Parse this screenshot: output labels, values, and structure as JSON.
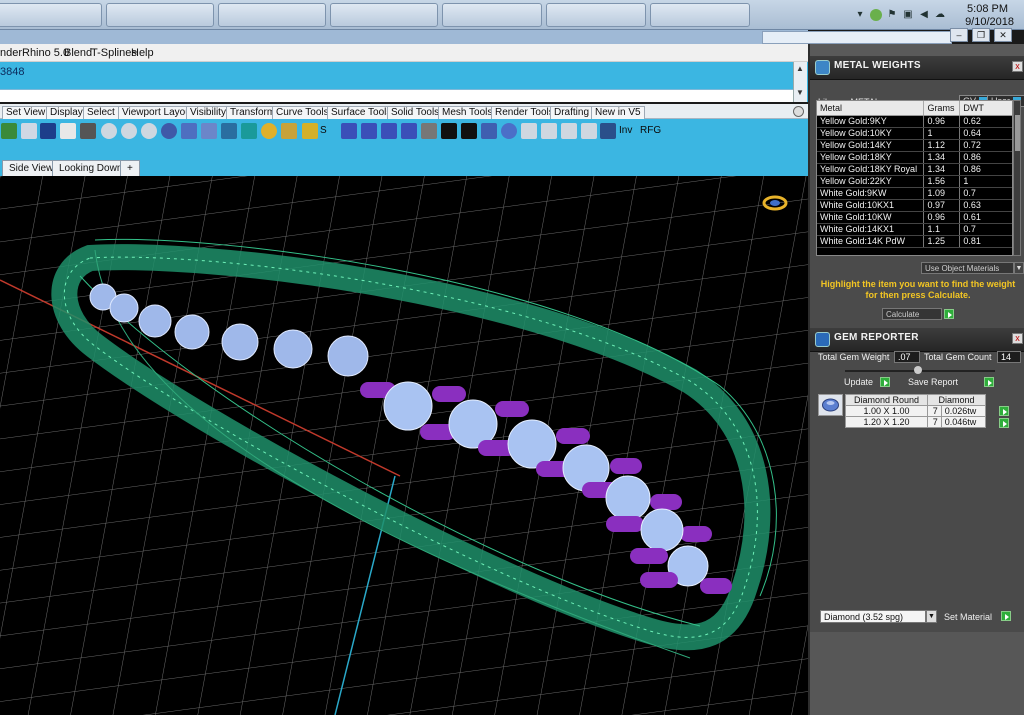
{
  "taskbar": {
    "time": "5:08 PM",
    "date": "9/10/2018",
    "tray_icons": [
      "chevron-up-icon",
      "security-icon",
      "flag-icon",
      "network-icon",
      "volume-icon",
      "cloud-icon"
    ]
  },
  "menubar": {
    "items": [
      "nder",
      "Rhino 5.0",
      "Blend",
      "T-Splines",
      "Help"
    ]
  },
  "command": {
    "history_text": "3848"
  },
  "toolbar_tabs": [
    "Set View",
    "Display",
    "Select",
    "Viewport Layout",
    "Visibility",
    "Transform",
    "Curve Tools",
    "Surface Tools",
    "Solid Tools",
    "Mesh Tools",
    "Render Tools",
    "Drafting",
    "New in V5"
  ],
  "icon_toolbar": {
    "label_s": "S",
    "label_inv": "Inv",
    "label_rfg": "RFG"
  },
  "viewport_tabs": [
    "Side View",
    "Looking Down",
    "+"
  ],
  "metal_weights": {
    "title": "METAL WEIGHTS",
    "library_label": "Library: METAL",
    "gv_label": "GV",
    "user_label": "User",
    "columns": [
      "Metal",
      "Grams",
      "DWT"
    ],
    "rows": [
      [
        "Yellow Gold:9KY",
        "0.96",
        "0.62"
      ],
      [
        "Yellow Gold:10KY",
        "1",
        "0.64"
      ],
      [
        "Yellow Gold:14KY",
        "1.12",
        "0.72"
      ],
      [
        "Yellow Gold:18KY",
        "1.34",
        "0.86"
      ],
      [
        "Yellow Gold:18KY Royal",
        "1.34",
        "0.86"
      ],
      [
        "Yellow Gold:22KY",
        "1.56",
        "1"
      ],
      [
        "White Gold:9KW",
        "1.09",
        "0.7"
      ],
      [
        "White Gold:10KX1",
        "0.97",
        "0.63"
      ],
      [
        "White Gold:10KW",
        "0.96",
        "0.61"
      ],
      [
        "White Gold:14KX1",
        "1.1",
        "0.7"
      ],
      [
        "White Gold:14K PdW",
        "1.25",
        "0.81"
      ]
    ],
    "use_object_materials": "Use Object Materials",
    "hint": "Highlight the item you want to find the weight for then press Calculate.",
    "calculate_label": "Calculate"
  },
  "gem_reporter": {
    "title": "GEM REPORTER",
    "total_gem_weight_label": "Total Gem Weight",
    "total_gem_weight_value": ".07",
    "total_gem_count_label": "Total Gem Count",
    "total_gem_count_value": "14",
    "update_label": "Update",
    "save_report_label": "Save Report",
    "table_header": [
      "Diamond Round",
      "Diamond"
    ],
    "rows": [
      [
        "1.00 X 1.00",
        "7",
        "0.026tw"
      ],
      [
        "1.20 X 1.20",
        "7",
        "0.046tw"
      ]
    ],
    "material_value": "Diamond    (3.52 spg)",
    "set_material_label": "Set Material"
  }
}
